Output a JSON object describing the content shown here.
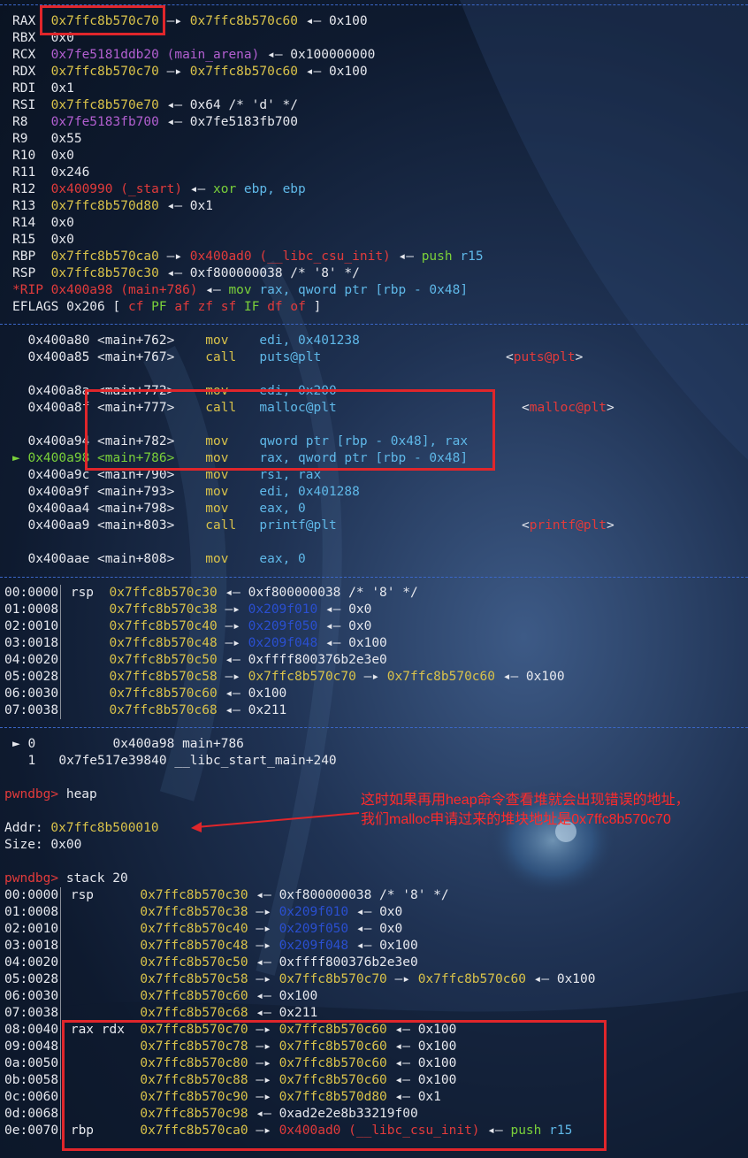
{
  "registers": [
    {
      "name": "RAX",
      "v": "0x7ffc8b570c70",
      "arrow": " —▸ ",
      "v2": "0x7ffc8b570c60",
      "arrow2": " ◂— ",
      "v3": "0x100"
    },
    {
      "name": "RBX",
      "v": "0x0"
    },
    {
      "name": "RCX",
      "v": "0x7fe5181ddb20",
      "sym": "(main_arena)",
      "arrow": " ◂— ",
      "v2": "0x100000000"
    },
    {
      "name": "RDX",
      "v": "0x7ffc8b570c70",
      "arrow": " —▸ ",
      "v2": "0x7ffc8b570c60",
      "arrow2": " ◂— ",
      "v3": "0x100"
    },
    {
      "name": "RDI",
      "v": "0x1"
    },
    {
      "name": "RSI",
      "v": "0x7ffc8b570e70",
      "arrow": " ◂— ",
      "v2": "0x64 /* 'd' */"
    },
    {
      "name": "R8",
      "v": "0x7fe5183fb700",
      "arrow": " ◂— ",
      "v2": "0x7fe5183fb700"
    },
    {
      "name": "R9",
      "v": "0x55"
    },
    {
      "name": "R10",
      "v": "0x0"
    },
    {
      "name": "R11",
      "v": "0x246"
    },
    {
      "name": "R12",
      "v": "0x400990",
      "sym": "(_start)",
      "arrow": " ◂— ",
      "ins": "xor",
      "ops": "ebp, ebp"
    },
    {
      "name": "R13",
      "v": "0x7ffc8b570d80",
      "arrow": " ◂— ",
      "v2": "0x1"
    },
    {
      "name": "R14",
      "v": "0x0"
    },
    {
      "name": "R15",
      "v": "0x0"
    },
    {
      "name": "RBP",
      "v": "0x7ffc8b570ca0",
      "arrow": " —▸ ",
      "v2": "0x400ad0",
      "sym2": "(__libc_csu_init)",
      "arrow2": " ◂— ",
      "ins": "push",
      "ops": "r15"
    },
    {
      "name": "RSP",
      "v": "0x7ffc8b570c30",
      "arrow": " ◂— ",
      "v2": "0xf800000038 /* '8' */"
    },
    {
      "name": "*RIP",
      "v": "0x400a98",
      "sym": "(main+786)",
      "arrow": " ◂— ",
      "ins": "mov",
      "ops": "rax, qword ptr [rbp - 0x48]"
    },
    {
      "name": "EFLAGS",
      "v": "0x206",
      "flags": "[ cf PF af zf sf IF df of ]"
    }
  ],
  "disasm": [
    {
      "addr": "0x400a80",
      "sym": "<main+762>",
      "op": "mov",
      "args": "edi, 0x401238",
      "cmt": ""
    },
    {
      "addr": "0x400a85",
      "sym": "<main+767>",
      "op": "call",
      "args": "puts@plt",
      "cmt": "<puts@plt>"
    },
    {
      "addr": "0x400a8a",
      "sym": "<main+772>",
      "op": "mov",
      "args": "edi, 0x200",
      "cmt": ""
    },
    {
      "addr": "0x400a8f",
      "sym": "<main+777>",
      "op": "call",
      "args": "malloc@plt",
      "cmt": "<malloc@plt>"
    },
    {
      "addr": "0x400a94",
      "sym": "<main+782>",
      "op": "mov",
      "args": "qword ptr [rbp - 0x48], rax",
      "cmt": ""
    },
    {
      "addr": "0x400a98",
      "sym": "<main+786>",
      "op": "mov",
      "args": "rax, qword ptr [rbp - 0x48]",
      "cmt": "",
      "cur": true
    },
    {
      "addr": "0x400a9c",
      "sym": "<main+790>",
      "op": "mov",
      "args": "rsi, rax",
      "cmt": ""
    },
    {
      "addr": "0x400a9f",
      "sym": "<main+793>",
      "op": "mov",
      "args": "edi, 0x401288",
      "cmt": ""
    },
    {
      "addr": "0x400aa4",
      "sym": "<main+798>",
      "op": "mov",
      "args": "eax, 0",
      "cmt": ""
    },
    {
      "addr": "0x400aa9",
      "sym": "<main+803>",
      "op": "call",
      "args": "printf@plt",
      "cmt": "<printf@plt>"
    },
    {
      "addr": "0x400aae",
      "sym": "<main+808>",
      "op": "mov",
      "args": "eax, 0",
      "cmt": ""
    }
  ],
  "stack1": [
    {
      "idx": "00:0000",
      "reg": "rsp",
      "addr": "0x7ffc8b570c30",
      "a": " ◂— ",
      "rest": "0xf800000038 /* '8' */"
    },
    {
      "idx": "01:0008",
      "reg": "",
      "addr": "0x7ffc8b570c38",
      "a": " —▸ ",
      "ptr": "0x209f010",
      "a2": " ◂— ",
      "rest": "0x0"
    },
    {
      "idx": "02:0010",
      "reg": "",
      "addr": "0x7ffc8b570c40",
      "a": " —▸ ",
      "ptr": "0x209f050",
      "a2": " ◂— ",
      "rest": "0x0"
    },
    {
      "idx": "03:0018",
      "reg": "",
      "addr": "0x7ffc8b570c48",
      "a": " —▸ ",
      "ptr": "0x209f048",
      "a2": " ◂— ",
      "rest": "0x100"
    },
    {
      "idx": "04:0020",
      "reg": "",
      "addr": "0x7ffc8b570c50",
      "a": " ◂— ",
      "rest": "0xffff800376b2e3e0"
    },
    {
      "idx": "05:0028",
      "reg": "",
      "addr": "0x7ffc8b570c58",
      "a": " —▸ ",
      "y2": "0x7ffc8b570c70",
      "a2": " —▸ ",
      "y3": "0x7ffc8b570c60",
      "a3": " ◂— ",
      "rest": "0x100"
    },
    {
      "idx": "06:0030",
      "reg": "",
      "addr": "0x7ffc8b570c60",
      "a": " ◂— ",
      "rest": "0x100"
    },
    {
      "idx": "07:0038",
      "reg": "",
      "addr": "0x7ffc8b570c68",
      "a": " ◂— ",
      "rest": "0x211"
    }
  ],
  "backtrace": [
    {
      "mark": "►",
      "n": "0",
      "addr": "0x400a98",
      "fn": "main+786"
    },
    {
      "mark": "",
      "n": "1",
      "addr": "0x7fe517e39840",
      "fn": "__libc_start_main+240"
    }
  ],
  "prompt1": "pwndbg>",
  "cmd1": "heap",
  "heap_addr_label": "Addr:",
  "heap_addr": "0x7ffc8b500010",
  "heap_size": "Size: 0x00",
  "note": "这时如果再用heap命令查看堆就会出现错误的地址，\n我们malloc申请过来的堆块地址是0x7ffc8b570c70",
  "prompt2": "pwndbg>",
  "cmd2": "stack 20",
  "stack2": [
    {
      "idx": "00:0000",
      "reg": "rsp",
      "addr": "0x7ffc8b570c30",
      "a": " ◂— ",
      "rest": "0xf800000038 /* '8' */"
    },
    {
      "idx": "01:0008",
      "reg": "",
      "addr": "0x7ffc8b570c38",
      "a": " —▸ ",
      "ptr": "0x209f010",
      "a2": " ◂— ",
      "rest": "0x0"
    },
    {
      "idx": "02:0010",
      "reg": "",
      "addr": "0x7ffc8b570c40",
      "a": " —▸ ",
      "ptr": "0x209f050",
      "a2": " ◂— ",
      "rest": "0x0"
    },
    {
      "idx": "03:0018",
      "reg": "",
      "addr": "0x7ffc8b570c48",
      "a": " —▸ ",
      "ptr": "0x209f048",
      "a2": " ◂— ",
      "rest": "0x100"
    },
    {
      "idx": "04:0020",
      "reg": "",
      "addr": "0x7ffc8b570c50",
      "a": " ◂— ",
      "rest": "0xffff800376b2e3e0"
    },
    {
      "idx": "05:0028",
      "reg": "",
      "addr": "0x7ffc8b570c58",
      "a": " —▸ ",
      "y2": "0x7ffc8b570c70",
      "a2": " —▸ ",
      "y3": "0x7ffc8b570c60",
      "a3": " ◂— ",
      "rest": "0x100"
    },
    {
      "idx": "06:0030",
      "reg": "",
      "addr": "0x7ffc8b570c60",
      "a": " ◂— ",
      "rest": "0x100"
    },
    {
      "idx": "07:0038",
      "reg": "",
      "addr": "0x7ffc8b570c68",
      "a": " ◂— ",
      "rest": "0x211"
    },
    {
      "idx": "08:0040",
      "reg": "rax rdx",
      "addr": "0x7ffc8b570c70",
      "a": " —▸ ",
      "y2": "0x7ffc8b570c60",
      "a2": " ◂— ",
      "rest": "0x100"
    },
    {
      "idx": "09:0048",
      "reg": "",
      "addr": "0x7ffc8b570c78",
      "a": " —▸ ",
      "y2": "0x7ffc8b570c60",
      "a2": " ◂— ",
      "rest": "0x100"
    },
    {
      "idx": "0a:0050",
      "reg": "",
      "addr": "0x7ffc8b570c80",
      "a": " —▸ ",
      "y2": "0x7ffc8b570c60",
      "a2": " ◂— ",
      "rest": "0x100"
    },
    {
      "idx": "0b:0058",
      "reg": "",
      "addr": "0x7ffc8b570c88",
      "a": " —▸ ",
      "y2": "0x7ffc8b570c60",
      "a2": " ◂— ",
      "rest": "0x100"
    },
    {
      "idx": "0c:0060",
      "reg": "",
      "addr": "0x7ffc8b570c90",
      "a": " —▸ ",
      "y2": "0x7ffc8b570d80",
      "a2": " ◂— ",
      "rest": "0x1"
    },
    {
      "idx": "0d:0068",
      "reg": "",
      "addr": "0x7ffc8b570c98",
      "a": " ◂— ",
      "rest": "0xad2e2e8b33219f00"
    },
    {
      "idx": "0e:0070",
      "reg": "rbp",
      "addr": "0x7ffc8b570ca0",
      "a": " —▸ ",
      "r2": "0x400ad0",
      "sym2": "(__libc_csu_init)",
      "a2": " ◂— ",
      "ins": "push",
      "ops": "r15"
    }
  ]
}
